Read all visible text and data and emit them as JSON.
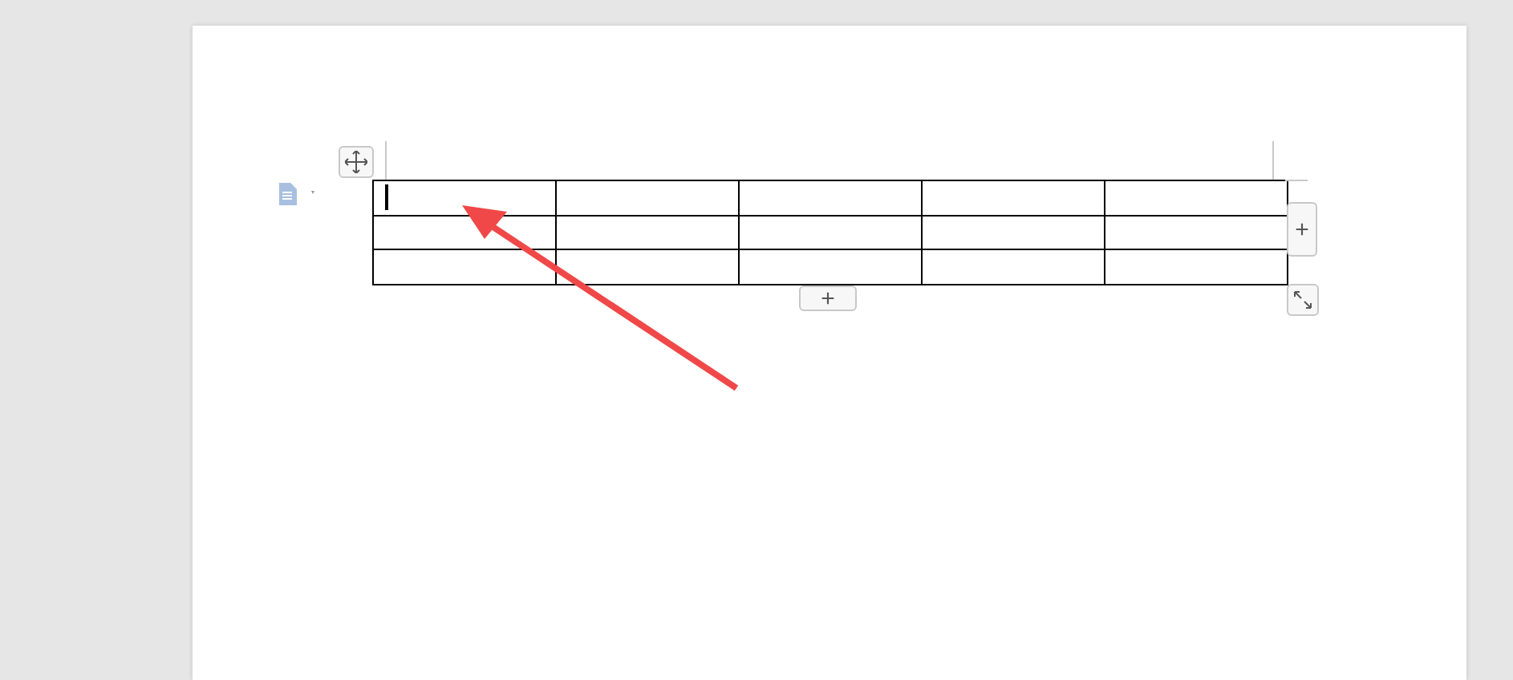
{
  "table": {
    "rows": [
      {
        "cells": [
          {
            "caret": true
          },
          {
            "caret": false
          },
          {
            "caret": false
          },
          {
            "caret": false
          },
          {
            "caret": false
          }
        ]
      },
      {
        "cells": [
          {
            "caret": false
          },
          {
            "caret": false
          },
          {
            "caret": false
          },
          {
            "caret": false
          },
          {
            "caret": false
          }
        ]
      },
      {
        "cells": [
          {
            "caret": false
          },
          {
            "caret": false
          },
          {
            "caret": false
          },
          {
            "caret": false
          },
          {
            "caret": false
          }
        ]
      }
    ]
  },
  "add_column_button": "+",
  "add_row_button": "+"
}
